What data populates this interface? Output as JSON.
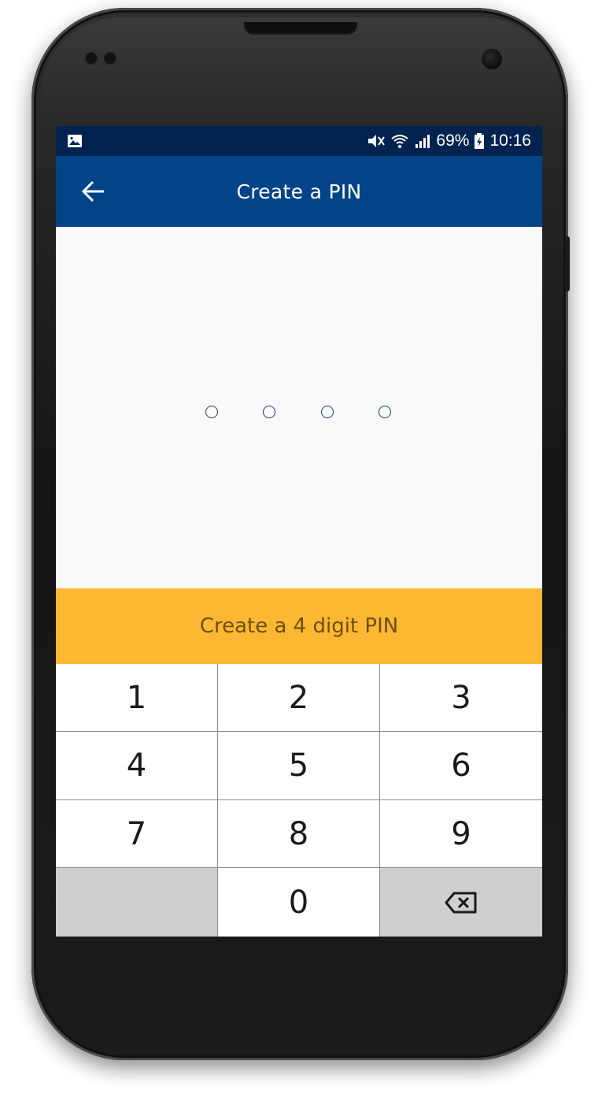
{
  "status_bar": {
    "battery_percent": "69%",
    "time": "10:16",
    "icons": [
      "image-notification-icon",
      "mute-icon",
      "wifi-icon",
      "signal-icon",
      "battery-icon"
    ]
  },
  "app_bar": {
    "title": "Create a PIN",
    "back_icon": "arrow-left-icon"
  },
  "pin": {
    "length": 4,
    "entered": 0
  },
  "prompt": {
    "text": "Create a 4 digit PIN"
  },
  "keypad": {
    "keys": [
      "1",
      "2",
      "3",
      "4",
      "5",
      "6",
      "7",
      "8",
      "9",
      "",
      "0",
      ""
    ],
    "delete_icon": "backspace-icon"
  },
  "colors": {
    "status_bar": "#022350",
    "app_bar": "#034488",
    "banner": "#fcb833",
    "banner_text": "#6c4f12",
    "pin_dot": "#1e3a78",
    "key_disabled": "#cfcfcf"
  }
}
